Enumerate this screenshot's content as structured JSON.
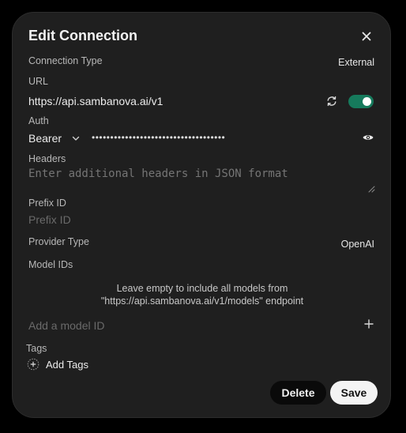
{
  "dialog": {
    "title": "Edit Connection"
  },
  "connection_type": {
    "label": "Connection Type",
    "value": "External"
  },
  "url": {
    "label": "URL",
    "value": "https://api.sambanova.ai/v1",
    "enabled": true
  },
  "auth": {
    "label": "Auth",
    "method": "Bearer",
    "masked_key": "••••••••••••••••••••••••••••••••••••"
  },
  "headers": {
    "label": "Headers",
    "placeholder": "Enter additional headers in JSON format"
  },
  "prefix_id": {
    "label": "Prefix ID",
    "placeholder": "Prefix ID"
  },
  "provider_type": {
    "label": "Provider Type",
    "value": "OpenAI"
  },
  "model_ids": {
    "label": "Model IDs",
    "hint_line1": "Leave empty to include all models from",
    "hint_line2": "\"https://api.sambanova.ai/v1/models\" endpoint",
    "input_placeholder": "Add a model ID"
  },
  "tags": {
    "label": "Tags",
    "add_label": "Add Tags"
  },
  "actions": {
    "delete_label": "Delete",
    "save_label": "Save"
  },
  "colors": {
    "toggle_on": "#167a5c",
    "background": "#1f1f1f"
  }
}
